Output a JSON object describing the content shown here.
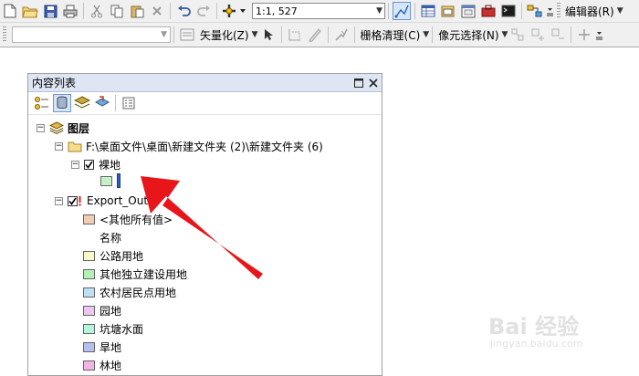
{
  "toolbar1": {
    "scale_value": "1:1, 527",
    "editor_label": "编辑器(R)",
    "icons": [
      "new-file-icon",
      "open-folder-icon",
      "save-icon",
      "print-icon",
      "cut-icon",
      "copy-icon",
      "paste-icon",
      "delete-icon",
      "undo-icon",
      "redo-icon",
      "add-data-icon",
      "editor-toolbar-icon",
      "table-icon",
      "catalog-icon",
      "toolbox-icon",
      "python-icon",
      "modelbuilder-icon"
    ]
  },
  "toolbar2": {
    "vectorize_label": "矢量化(Z)",
    "raster_cleanup_label": "栅格清理(C)",
    "cell_select_label": "像元选择(N)"
  },
  "toc": {
    "title": "内容列表",
    "root_label": "图层",
    "folder_path": "F:\\桌面文件\\桌面\\新建文件夹 (2)\\新建文件夹 (6)",
    "layer1": {
      "name": "裸地",
      "checked": true,
      "swatch_color": "#c8f0c8"
    },
    "layer2": {
      "name": "Export_Out",
      "classes": [
        {
          "label": "<其他所有值>",
          "color": "#f2cdb4"
        },
        {
          "label": "名称",
          "color": ""
        },
        {
          "label": "公路用地",
          "color": "#fafac8"
        },
        {
          "label": "其他独立建设用地",
          "color": "#b4f0b4"
        },
        {
          "label": "农村居民点用地",
          "color": "#bee0f5"
        },
        {
          "label": "园地",
          "color": "#ecc8f0"
        },
        {
          "label": "坑塘水面",
          "color": "#b4f5dc"
        },
        {
          "label": "旱地",
          "color": "#b4c0f0"
        },
        {
          "label": "林地",
          "color": "#f0b4e6"
        }
      ]
    }
  },
  "watermark": {
    "main": "Bai 经验",
    "sub": "jingyan.baidu.com"
  },
  "colors": {
    "arrow": "#e8161a"
  }
}
